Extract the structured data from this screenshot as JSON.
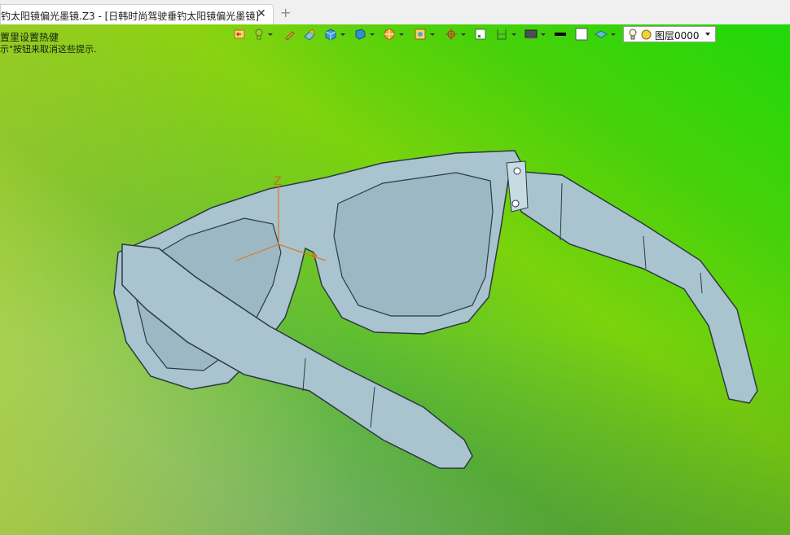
{
  "window": {
    "tab_title": "钓太阳镜偏光墨镜.Z3 - [日韩时尚驾驶垂钓太阳镜偏光墨镜]",
    "close_glyph": "✕",
    "new_tab_glyph": "+"
  },
  "hints": {
    "line1": "置里设置热健",
    "line2": "示\"按钮来取消这些提示."
  },
  "toolbar": {
    "icons": [
      "undo-icon",
      "lamp-icon",
      "pencil-icon",
      "shape-icon",
      "cube-icon",
      "shaded-cube-icon",
      "render-icon",
      "view-box-icon",
      "origin-icon",
      "frame-icon",
      "section-icon",
      "display-icon",
      "color-black-icon",
      "color-white-icon",
      "layer-plane-icon"
    ],
    "layer_select": {
      "value": "图层0000"
    }
  },
  "axis": {
    "z_label": "Z"
  },
  "colors": {
    "model_fill": "#a9c4cf",
    "model_stroke": "#2a3a42",
    "lens": "#9cb8c4"
  }
}
